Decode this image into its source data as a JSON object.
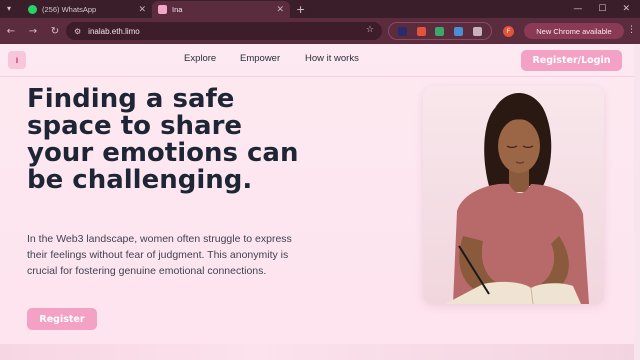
{
  "browser": {
    "tabs": [
      {
        "title": "(256) WhatsApp",
        "icon": "whatsapp-icon"
      },
      {
        "title": "Ina",
        "icon": "ina-favicon"
      }
    ],
    "url": "inalab.eth.limo",
    "profile_initial": "F",
    "update_label": "New Chrome available",
    "colors": {
      "frame": "#3a1f2b",
      "toolbar": "#5a2c3d",
      "omnibox": "#3d1d2a"
    }
  },
  "header": {
    "logo": "ı̇",
    "nav": [
      "Explore",
      "Empower",
      "How it works"
    ],
    "login_label": "Register/Login"
  },
  "hero": {
    "headline": "Finding a safe space to share your emotions can be challenging.",
    "lead": "In the Web3 landscape, women often struggle to express their feelings without fear of judgment. This anonymity is crucial for fostering genuine emotional connections.",
    "register_label": "Register",
    "image": "woman-writing-in-journal",
    "colors": {
      "accent": "#f3a2c5",
      "background": "#fde6ef",
      "heading": "#1e2535"
    }
  }
}
